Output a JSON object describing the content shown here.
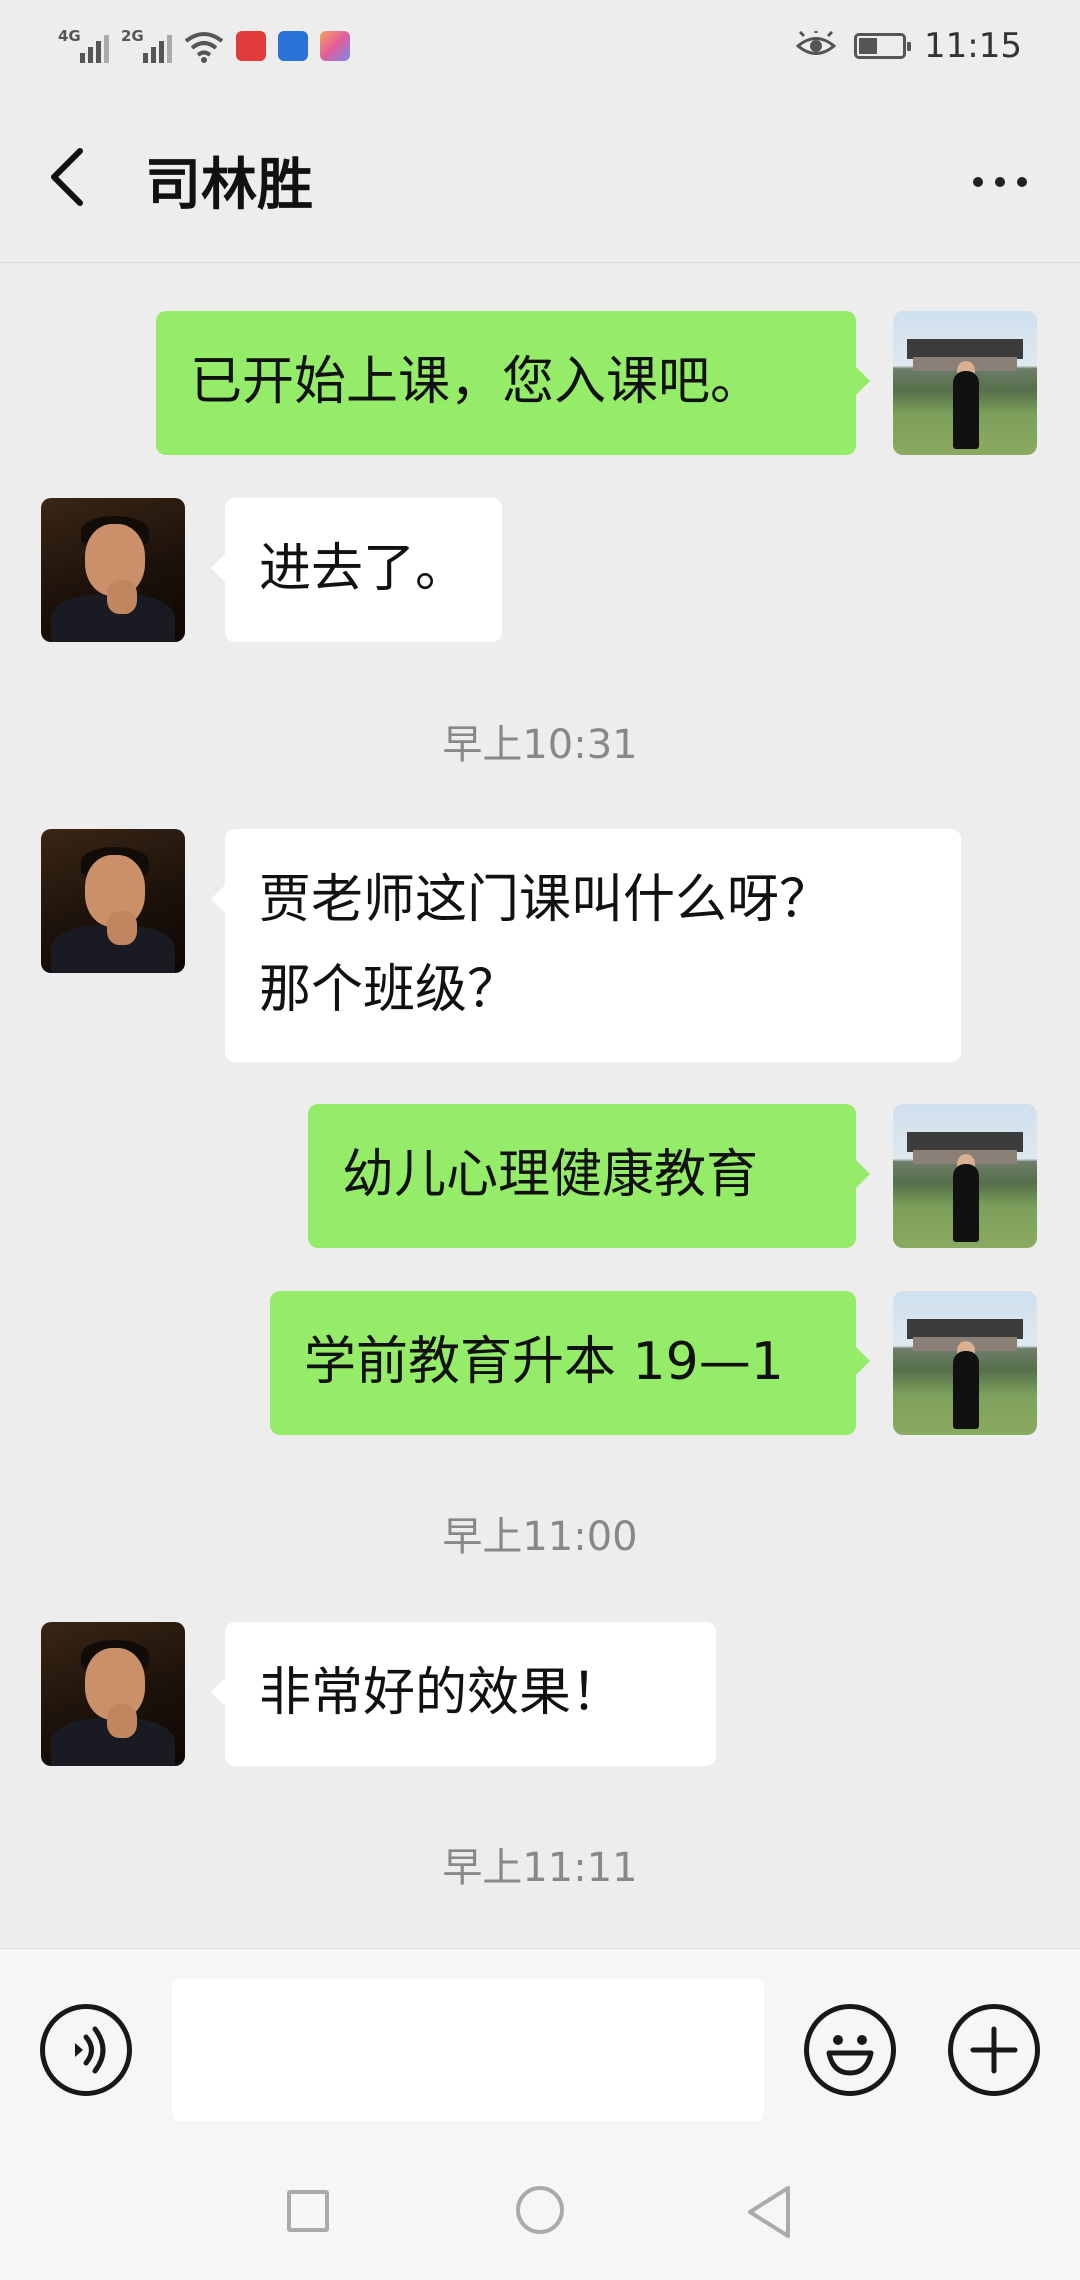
{
  "status_bar": {
    "network_1": "4G",
    "network_2": "2G",
    "time": "11:15",
    "icons": [
      "signal-icon",
      "signal-icon",
      "wifi-icon",
      "app-icon",
      "app-icon",
      "app-icon",
      "eye-icon",
      "battery-icon"
    ]
  },
  "header": {
    "title": "司林胜",
    "back_icon": "chevron-left-icon",
    "more_icon": "more-icon"
  },
  "messages": [
    {
      "from": "me",
      "text": "已开始上课，您入课吧。"
    },
    {
      "from": "them",
      "text": "进去了。"
    },
    {
      "type": "time",
      "text": "早上10:31"
    },
    {
      "from": "them",
      "lines": [
        "贾老师这门课叫什么呀？",
        "那个班级？"
      ]
    },
    {
      "from": "me",
      "text": "幼儿心理健康教育"
    },
    {
      "from": "me",
      "text": "学前教育升本 19—1"
    },
    {
      "type": "time",
      "text": "早上11:00"
    },
    {
      "from": "them",
      "text": "非常好的效果！"
    },
    {
      "type": "time",
      "text": "早上11:11"
    }
  ],
  "input_bar": {
    "value": "",
    "placeholder": "",
    "icons": [
      "voice-icon",
      "emoji-icon",
      "plus-icon"
    ]
  },
  "colors": {
    "background": "#ededed",
    "outgoing_bubble": "#95ec69",
    "incoming_bubble": "#ffffff",
    "timestamp": "#888888"
  }
}
